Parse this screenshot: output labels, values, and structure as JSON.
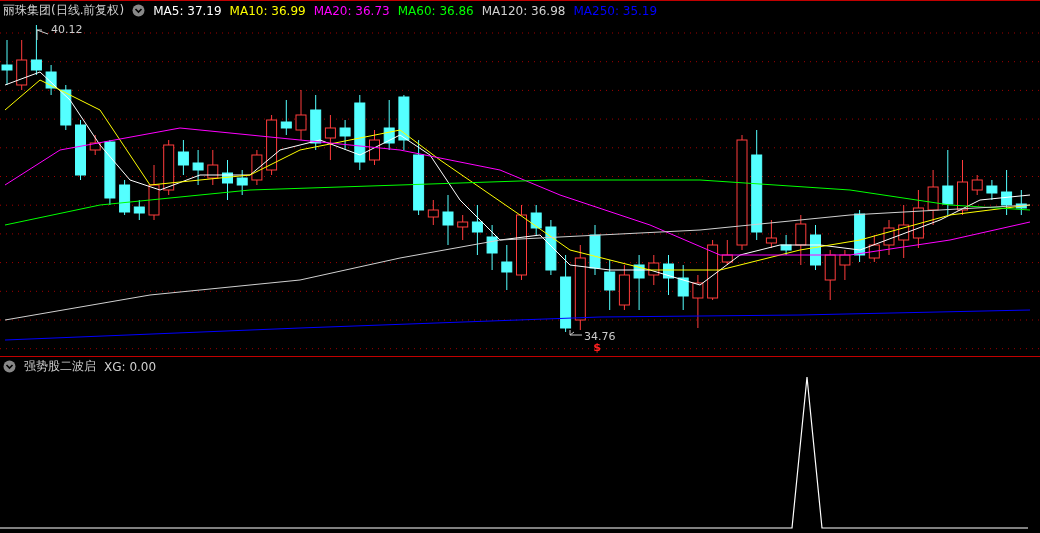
{
  "main_panel": {
    "title": "丽珠集团(日线.前复权)",
    "indicators": [
      {
        "label": "MA5: 37.19",
        "color": "#ffffff"
      },
      {
        "label": "MA10: 36.99",
        "color": "#ffff00"
      },
      {
        "label": "MA20: 36.73",
        "color": "#ff00ff"
      },
      {
        "label": "MA60: 36.86",
        "color": "#00ff00"
      },
      {
        "label": "MA120: 36.98",
        "color": "#d0d0d0"
      },
      {
        "label": "MA250: 35.19",
        "color": "#0000ff"
      }
    ],
    "high_label": "40.12",
    "low_label": "34.76",
    "signal_marker": "$"
  },
  "sub_panel": {
    "title": "强势股二波启",
    "reading": "XG: 0.00"
  }
}
